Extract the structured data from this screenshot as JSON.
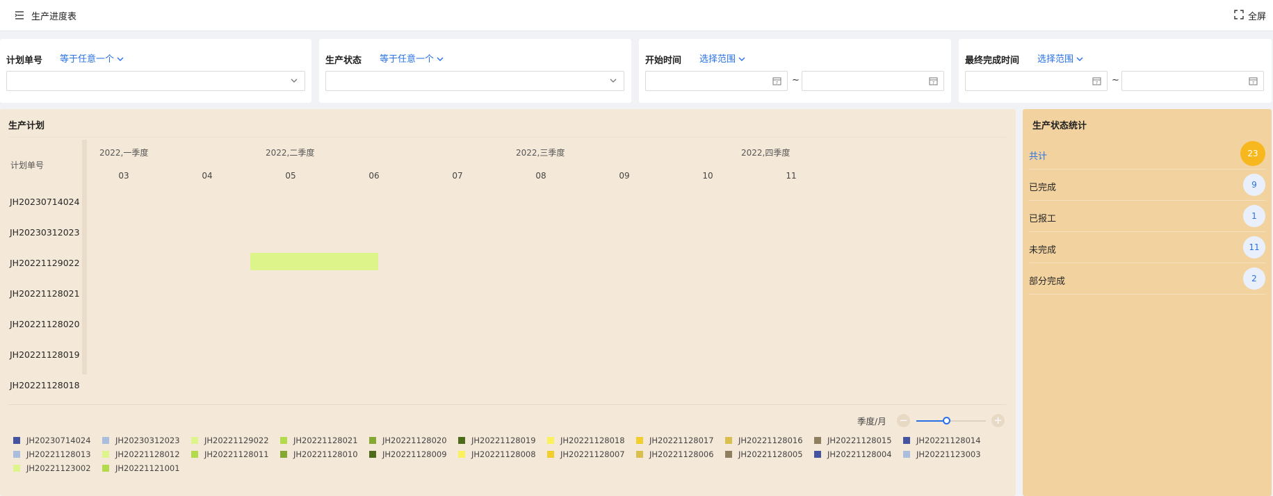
{
  "header": {
    "title": "生产进度表",
    "fullscreen_label": "全屏"
  },
  "filters": [
    {
      "label": "计划单号",
      "op": "等于任意一个",
      "value": ""
    },
    {
      "label": "生产状态",
      "op": "等于任意一个",
      "value": ""
    },
    {
      "label": "开始时间",
      "op": "选择范围",
      "from": "",
      "to": "",
      "separator": "~"
    },
    {
      "label": "最终完成时间",
      "op": "选择范围",
      "from": "",
      "to": "",
      "separator": "~"
    }
  ],
  "plan": {
    "title": "生产计划",
    "column_header": "计划单号",
    "quarters": [
      "2022,一季度",
      "2022,二季度",
      "2022,三季度",
      "2022,四季度"
    ],
    "months": [
      "03",
      "04",
      "05",
      "06",
      "07",
      "08",
      "09",
      "10",
      "11"
    ],
    "rows": [
      "JH20230714024",
      "JH20230312023",
      "JH20221129022",
      "JH20221128021",
      "JH20221128020",
      "JH20221128019",
      "JH20221128018"
    ],
    "bars": [
      {
        "row": "JH20221129022",
        "start_month": "04",
        "end_month": "05",
        "color": "#dcf48a"
      }
    ],
    "zoom": {
      "label": "季度/月",
      "minus": "−",
      "plus": "+",
      "level": 0.43
    },
    "legend": [
      {
        "name": "JH20230714024",
        "color": "#4454a0"
      },
      {
        "name": "JH20230312023",
        "color": "#a9bedc"
      },
      {
        "name": "JH20221129022",
        "color": "#dcf48a"
      },
      {
        "name": "JH20221128021",
        "color": "#b4d94a"
      },
      {
        "name": "JH20221128020",
        "color": "#86a832"
      },
      {
        "name": "JH20221128019",
        "color": "#4d6b1a"
      },
      {
        "name": "JH20221128018",
        "color": "#fbf15d"
      },
      {
        "name": "JH20221128017",
        "color": "#f2ce2c"
      },
      {
        "name": "JH20221128016",
        "color": "#d9bf4e"
      },
      {
        "name": "JH20221128015",
        "color": "#8f7f5e"
      },
      {
        "name": "JH20221128014",
        "color": "#4454a0"
      },
      {
        "name": "JH20221128013",
        "color": "#a9bedc"
      },
      {
        "name": "JH20221128012",
        "color": "#dcf48a"
      },
      {
        "name": "JH20221128011",
        "color": "#b4d94a"
      },
      {
        "name": "JH20221128010",
        "color": "#86a832"
      },
      {
        "name": "JH20221128009",
        "color": "#4d6b1a"
      },
      {
        "name": "JH20221128008",
        "color": "#fbf15d"
      },
      {
        "name": "JH20221128007",
        "color": "#f2ce2c"
      },
      {
        "name": "JH20221128006",
        "color": "#d9bf4e"
      },
      {
        "name": "JH20221128005",
        "color": "#8f7f5e"
      },
      {
        "name": "JH20221128004",
        "color": "#4454a0"
      },
      {
        "name": "JH20221123003",
        "color": "#a9bedc"
      },
      {
        "name": "JH20221123002",
        "color": "#dcf48a"
      },
      {
        "name": "JH20221121001",
        "color": "#b4d94a"
      }
    ]
  },
  "stats": {
    "title": "生产状态统计",
    "items": [
      {
        "label": "共计",
        "count": "23",
        "active": true
      },
      {
        "label": "已完成",
        "count": "9"
      },
      {
        "label": "已报工",
        "count": "1"
      },
      {
        "label": "未完成",
        "count": "11"
      },
      {
        "label": "部分完成",
        "count": "2"
      }
    ]
  },
  "colors": {
    "accent": "#2770e6",
    "plan_bg": "#f4e8d8",
    "stats_bg": "#f2d39f",
    "total_badge": "#f7b71e"
  }
}
